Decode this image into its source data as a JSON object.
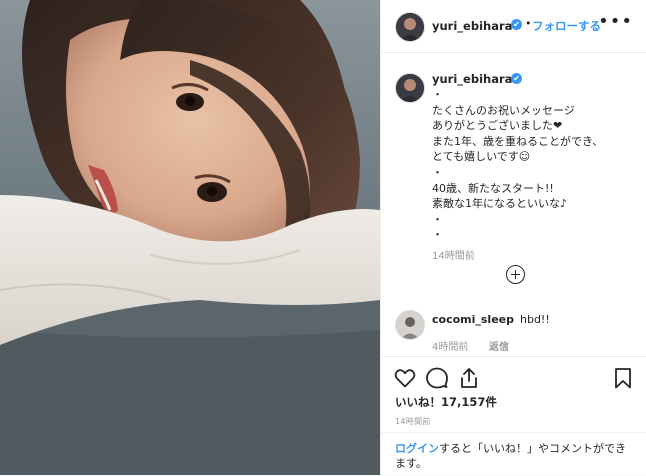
{
  "header": {
    "username": "yuri_ebihara",
    "verified_mark": "✔",
    "separator": "•",
    "follow_label": "フォローする",
    "more_label": "•••"
  },
  "caption": {
    "username": "yuri_ebihara",
    "verified_mark": "✔",
    "text": "・\nたくさんのお祝いメッセージ\nありがとうございました❤︎\nまた1年、歳を重ねることができ、\nとても嬉しいです☺︎\n・\n40歳、新たなスタート!!\n素敵な1年になるといいな♪\n・\n・",
    "time": "14時間前"
  },
  "comment": {
    "username": "cocomi_sleep",
    "text": "hbd!!",
    "time": "4時間前",
    "reply_label": "返信"
  },
  "actions": {
    "icons": [
      "heart-icon",
      "comment-icon",
      "share-icon",
      "bookmark-icon"
    ],
    "likes_text": "いいね！17,157件",
    "time": "14時間前"
  },
  "login_prompt": {
    "link": "ログイン",
    "rest": "すると「いいね！」やコメントができます。"
  },
  "colors": {
    "accent": "#3897f0",
    "text": "#262626",
    "muted": "#999999",
    "border": "#efefef"
  }
}
